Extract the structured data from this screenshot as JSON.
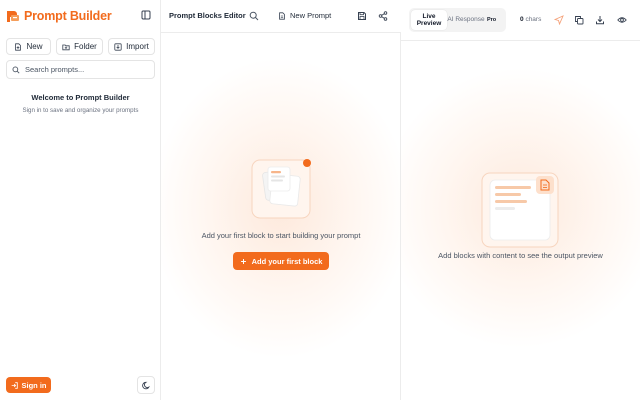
{
  "brand": {
    "name": "Prompt Builder"
  },
  "sidebar": {
    "actions": {
      "new_label": "New",
      "folder_label": "Folder",
      "import_label": "Import"
    },
    "search_placeholder": "Search prompts...",
    "welcome_title": "Welcome to Prompt Builder",
    "welcome_subtitle": "Sign in to save and organize your prompts",
    "signin_label": "Sign in"
  },
  "editor": {
    "title": "Prompt Blocks Editor",
    "prompt_tab_label": "New Prompt",
    "empty_text": "Add your first block to start building your prompt",
    "add_first_label": "Add your first block"
  },
  "preview": {
    "tab_live": "Live Preview",
    "tab_ai": "AI Response",
    "pro_badge": "Pro",
    "char_count": "0",
    "char_unit": "chars",
    "empty_text": "Add blocks with content to see the output preview"
  },
  "colors": {
    "accent": "#f26b1d",
    "accent_light": "#fde9dc",
    "border": "#e4e4e4"
  },
  "icons": [
    "brand-logo-icon",
    "sidebar-collapse-icon",
    "new-file-icon",
    "folder-icon",
    "import-icon",
    "search-icon",
    "sign-in-icon",
    "moon-icon",
    "file-icon",
    "save-icon",
    "share-icon",
    "plus-icon",
    "send-icon",
    "copy-icon",
    "download-icon",
    "eye-icon"
  ]
}
